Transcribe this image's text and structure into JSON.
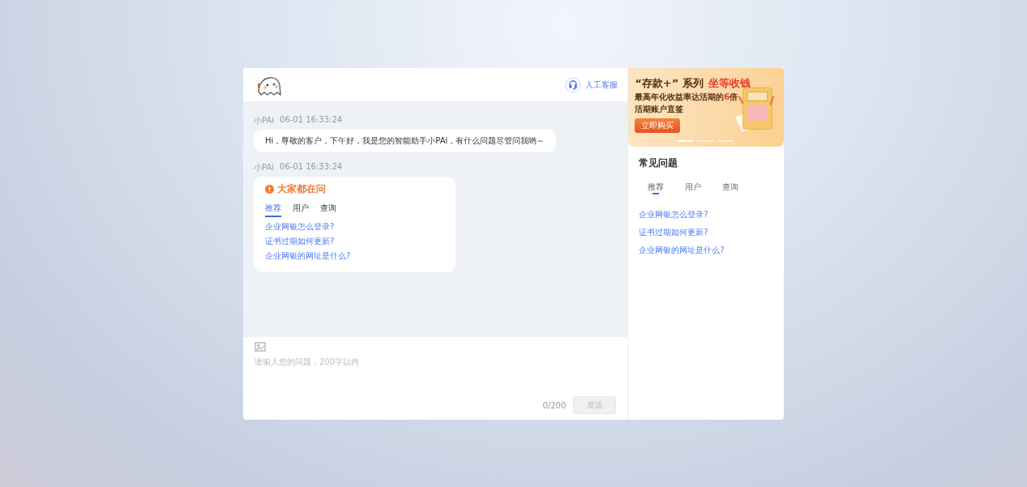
{
  "header": {
    "service_button": "人工客服"
  },
  "messages": [
    {
      "kind": "text",
      "sender": "小PAi",
      "time": "06-01 16:33:24",
      "text": "Hi，尊敬的客户，下午好，我是您的智能助手小PAi，有什么问题尽管问我哟～"
    },
    {
      "kind": "faq",
      "sender": "小PAi",
      "time": "06-01 16:33:24",
      "title": "大家都在问",
      "tabs": [
        {
          "label": "推荐",
          "selected": true
        },
        {
          "label": "用户",
          "selected": false
        },
        {
          "label": "查询",
          "selected": false
        }
      ],
      "links": [
        "企业网银怎么登录?",
        "证书过期如何更新?",
        "企业网银的网址是什么?"
      ]
    }
  ],
  "composer": {
    "placeholder": "请输入您的问题，200字以内",
    "counter": "0/200",
    "send_button": {
      "label": "发送",
      "disabled": true
    }
  },
  "banner": {
    "title_prefix": "“存款+” 系列",
    "title_highlight": "坐等收钱",
    "line_1": "最高年化收益率达活期的**6**倍",
    "line_2": "活期账户直签",
    "button": "立即购买",
    "dots": [
      {
        "selected": true
      },
      {
        "selected": false
      },
      {
        "selected": false
      }
    ]
  },
  "faq_panel": {
    "title": "常见问题",
    "tabs": [
      {
        "label": "推荐",
        "selected": true
      },
      {
        "label": "用户",
        "selected": false
      },
      {
        "label": "查询",
        "selected": false
      }
    ],
    "links": [
      "企业网银怎么登录?",
      "证书过期如何更新?",
      "企业网银的网址是什么?"
    ]
  }
}
